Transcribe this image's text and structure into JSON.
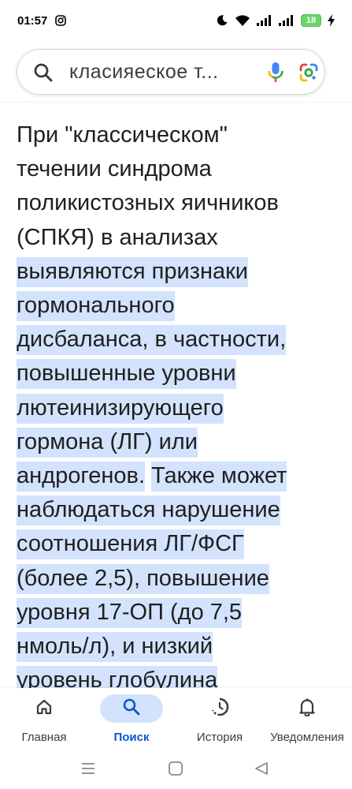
{
  "status_bar": {
    "time": "01:57",
    "battery": "18",
    "icons": [
      "instagram-icon",
      "moon-icon",
      "wifi-icon",
      "signal-icon",
      "signal-icon",
      "charging-icon"
    ]
  },
  "search": {
    "query": "класияеское т...",
    "icons": [
      "search-icon",
      "mic-icon",
      "google-lens-icon"
    ]
  },
  "article": {
    "lines": [
      "При \"классическом\"",
      "течении синдрома",
      "поликистозных яичников",
      "(СПКЯ) в анализах"
    ],
    "highlight_1": [
      "выявляются признаки",
      "гормонального",
      "дисбаланса, в частности,",
      "повышенные уровни",
      "лютеинизирующего",
      "гормона (ЛГ) или",
      "андрогенов."
    ],
    "highlight_2": [
      "Также может",
      "наблюдаться нарушение",
      "соотношения ЛГ/ФСГ",
      "(более 2,5), повышение",
      "уровня 17-ОП (до 7,5",
      "нмоль/л), и низкий",
      "уровень глобулина"
    ]
  },
  "bottom_nav": {
    "items": [
      {
        "label": "Главная",
        "icon": "home-icon"
      },
      {
        "label": "Поиск",
        "icon": "search-icon",
        "active": true
      },
      {
        "label": "История",
        "icon": "history-icon"
      },
      {
        "label": "Уведомления",
        "icon": "bell-icon"
      }
    ]
  },
  "system_nav": {
    "icons": [
      "menu-icon",
      "home-square-icon",
      "back-icon"
    ]
  },
  "colors": {
    "highlight": "#d3e3fd",
    "active_nav": "#0b57d0",
    "text": "#1f1f1f"
  }
}
